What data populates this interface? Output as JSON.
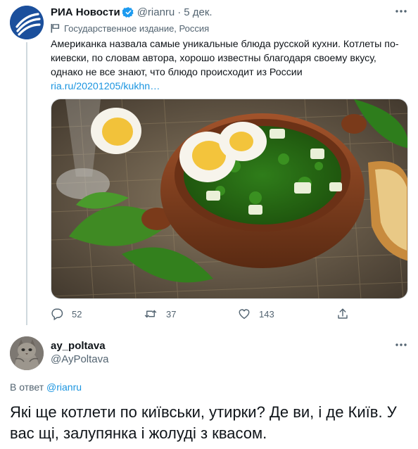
{
  "tweet": {
    "author_name": "РИА Новости",
    "handle": "@rianru",
    "separator": "·",
    "date": "5 дек.",
    "label": "Государственное издание, Россия",
    "text": "Американка назвала самые уникальные блюда русской кухни. Котлеты по-киевски, по словам автора, хорошо известны благодаря своему вкусу, однако не все знают, что блюдо происходит из России",
    "link": "ria.ru/20201205/kukhn…",
    "media_icon": "photo-sorrel-soup",
    "actions": {
      "replies": "52",
      "retweets": "37",
      "likes": "143"
    }
  },
  "reply": {
    "author_name": "ay_poltava",
    "handle": "@AyPoltava",
    "reply_to_prefix": "В ответ",
    "reply_to_handle": "@rianru",
    "text": "Які ще котлети по київськи, утирки? Де ви, і де Київ. У вас щі, залупянка і жолуді з квасом."
  },
  "colors": {
    "accent": "#1b95e0",
    "secondary_text": "#536471",
    "primary_text": "#0f1419",
    "verified": "#1d9bf0"
  }
}
